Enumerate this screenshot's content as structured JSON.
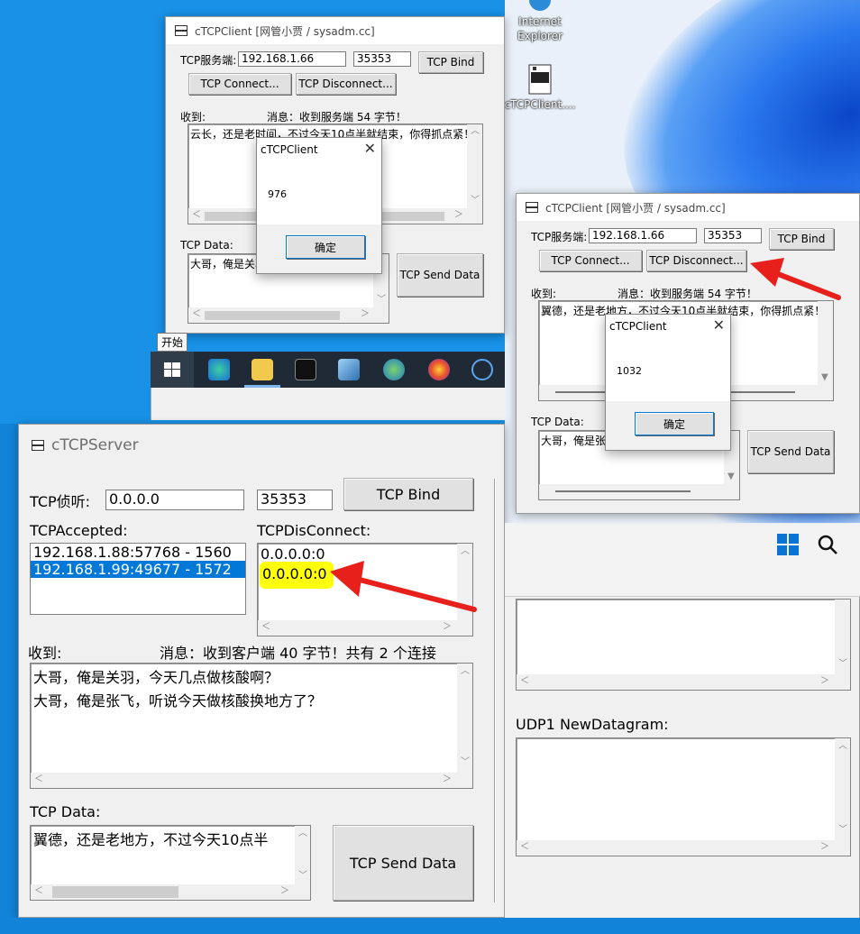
{
  "desktop": {
    "icons": [
      {
        "label_line1": "Internet",
        "label_line2": "Explorer",
        "icon": "internet-explorer-icon"
      },
      {
        "label_line1": "cTCPClient....",
        "label_line2": "",
        "icon": "app-icon"
      }
    ],
    "start_tooltip": "开始"
  },
  "client1": {
    "title": "cTCPClient [网管小贾 / sysadm.cc]",
    "server_label": "TCP服务端:",
    "server_ip": "192.168.1.66",
    "server_port": "35353",
    "bind_label": "TCP Bind",
    "connect_label": "TCP Connect...",
    "disconnect_label": "TCP Disconnect...",
    "received_label": "收到:",
    "message_text": "消息：收到服务端 54 字节！",
    "received_text": "云长，还是老时间，不过今天10点半就结束，你得抓点紧！",
    "tcp_data_label": "TCP Data:",
    "tcp_data_text": "大哥，俺是关羽",
    "send_label": "TCP Send Data",
    "msgbox": {
      "title": "cTCPClient",
      "value": "976",
      "ok_label": "确定"
    }
  },
  "client2": {
    "title": "cTCPClient [网管小贾 / sysadm.cc]",
    "server_label": "TCP服务端:",
    "server_ip": "192.168.1.66",
    "server_port": "35353",
    "bind_label": "TCP Bind",
    "connect_label": "TCP Connect...",
    "disconnect_label": "TCP Disconnect...",
    "received_label": "收到:",
    "message_text": "消息：收到服务端 54 字节！",
    "received_text": "翼德，还是老地方，不过今天10点半就结束，你得抓点紧！",
    "tcp_data_label": "TCP Data:",
    "tcp_data_text": "大哥，俺是张",
    "send_label": "TCP Send Data",
    "msgbox": {
      "title": "cTCPClient",
      "value": "1032",
      "ok_label": "确定"
    }
  },
  "server": {
    "title": "cTCPServer",
    "listen_label": "TCP侦听:",
    "listen_ip": "0.0.0.0",
    "listen_port": "35353",
    "bind_label": "TCP Bind",
    "accepted_label": "TCPAccepted:",
    "accepted": [
      "192.168.1.88:57768 - 1560",
      "192.168.1.99:49677 - 1572"
    ],
    "accepted_selected_index": 1,
    "disconnect_label": "TCPDisConnect:",
    "disconnected": [
      "0.0.0.0:0",
      "0.0.0.0:0"
    ],
    "received_label": "收到:",
    "message_text": "消息：收到客户端 40 字节！共有 2 个连接",
    "received_lines": [
      "大哥，俺是关羽，今天几点做核酸啊？",
      "大哥，俺是张飞，听说今天做核酸换地方了？"
    ],
    "tcp_data_label": "TCP Data:",
    "tcp_data_text": "翼德，还是老地方，不过今天10点半",
    "send_label": "TCP Send Data",
    "udp_label": "UDP1 NewDatagram:"
  },
  "colors": {
    "win10_desktop": "#1891e6",
    "selection": "#0078d7",
    "highlight": "#ffff00",
    "arrow": "#e8201c"
  }
}
